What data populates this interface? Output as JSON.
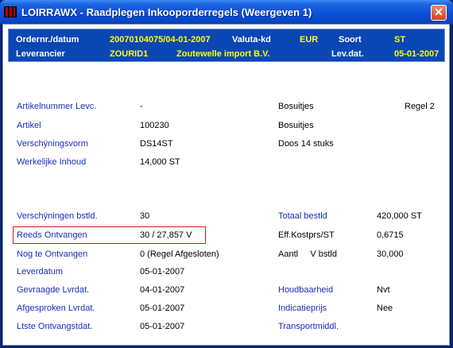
{
  "window": {
    "title": "LOIRRAWX - Raadplegen Inkooporderregels (Weergeven 1)",
    "close_glyph": "✕"
  },
  "header": {
    "ordernr_label": "Ordernr./datum",
    "ordernr_value": "20070104075/04-01-2007",
    "valuta_label": "Valuta-kd",
    "valuta_value": "EUR",
    "soort_label": "Soort",
    "soort_value": "ST",
    "leverancier_label": "Leverancier",
    "leverancier_code": "ZOURID1",
    "leverancier_name": "Zoutewelle import B.V.",
    "levdat_label": "Lev.dat.",
    "levdat_value": "05-01-2007"
  },
  "article": {
    "artikelnummer_levc_label": "Artikelnummer Levc.",
    "artikelnummer_levc_value": "-",
    "artikelnummer_levc_desc": "Bosuitjes",
    "regel": "Regel 2",
    "artikel_label": "Artikel",
    "artikel_value": "100230",
    "artikel_desc": "Bosuitjes",
    "verschijningsvorm_label": "Verschÿningsvorm",
    "verschijningsvorm_value": "DS14ST",
    "verschijningsvorm_desc": "Doos 14 stuks",
    "werkelijke_inhoud_label": "Werkelijke Inhoud",
    "werkelijke_inhoud_value": "14,000 ST"
  },
  "details": {
    "verschijningen_label": "Verschÿningen bstld.",
    "verschijningen_value": "30",
    "reeds_ontvangen_label": "Reeds  Ontvangen",
    "reeds_ontvangen_value": "30 / 27,857 V",
    "nog_te_ontvangen_label": "Nog te Ontvangen",
    "nog_te_ontvangen_value": "0  (Regel Afgesloten)",
    "leverdatum_label": "Leverdatum",
    "leverdatum_value": "05-01-2007",
    "gevraagde_label": "Gevraagde Lvrdat.",
    "gevraagde_value": "04-01-2007",
    "afgesproken_label": "Afgesproken Lvrdat.",
    "afgesproken_value": "05-01-2007",
    "ltste_label": "Ltste Ontvangstdat.",
    "ltste_value": "05-01-2007",
    "totaal_label": "Totaal bestld",
    "totaal_value": "420,000 ST",
    "effkostprs_label": "Eff.Kostprs/ST",
    "effkostprs_value": "0,6715",
    "aantl_label": "Aantl     V bstld",
    "aantl_value": "30,000",
    "houdbaarheid_label": "Houdbaarheid",
    "houdbaarheid_value": "Nvt",
    "indicatieprijs_label": "Indicatieprijs",
    "indicatieprijs_value": "Nee",
    "transportmiddel_label": "Transportmiddl."
  }
}
